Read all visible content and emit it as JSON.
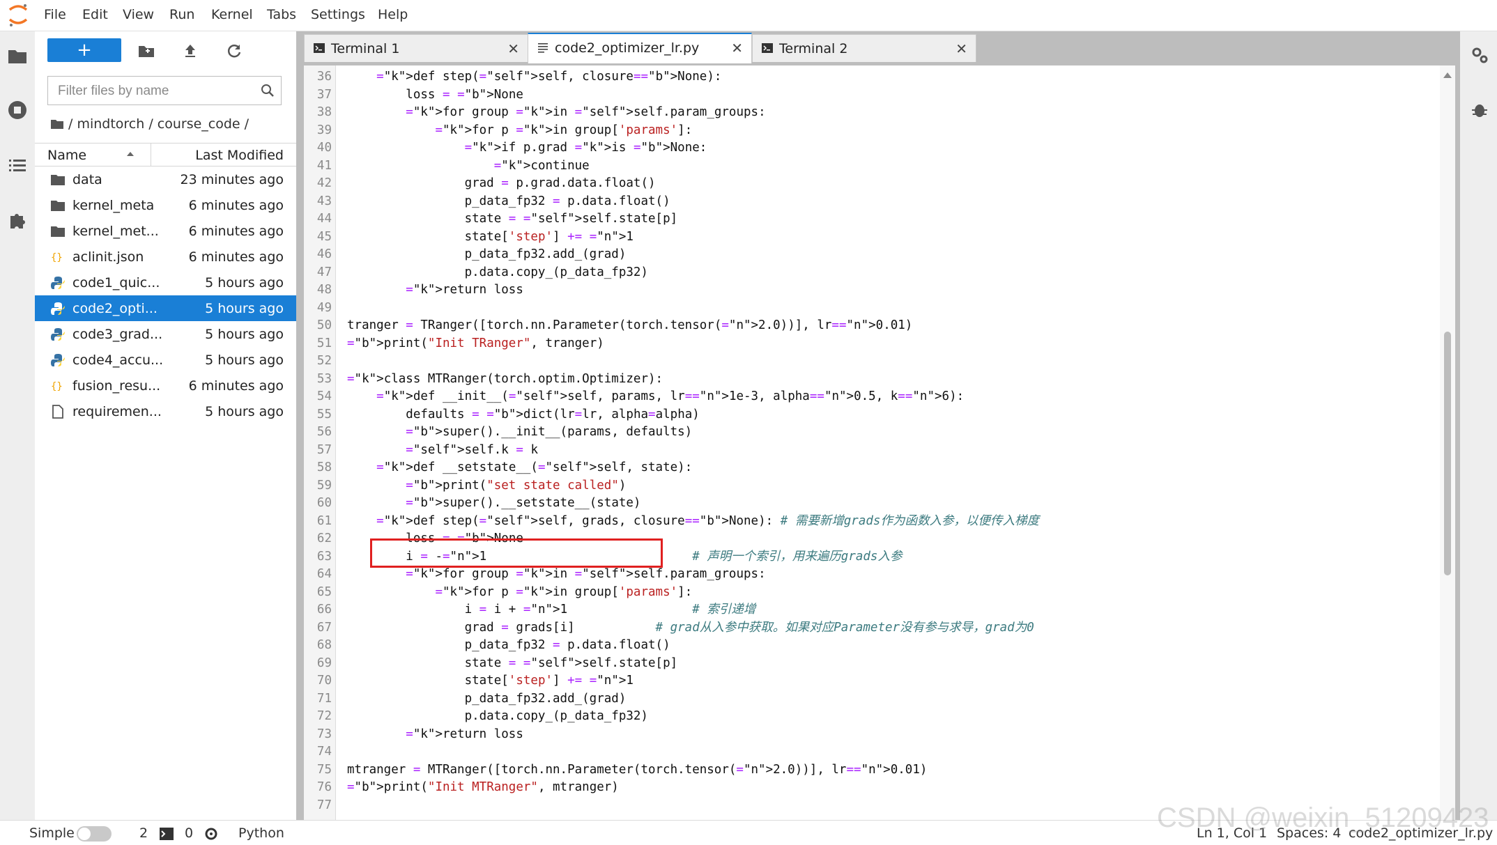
{
  "menubar": {
    "items": [
      "File",
      "Edit",
      "View",
      "Run",
      "Kernel",
      "Tabs",
      "Settings",
      "Help"
    ]
  },
  "filebrowser": {
    "new_label": "+",
    "filter_placeholder": "Filter files by name",
    "breadcrumb": "/ mindtorch / course_code /",
    "header": {
      "name": "Name",
      "modified": "Last Modified"
    },
    "files": [
      {
        "name": "data",
        "time": "23 minutes ago",
        "icon": "folder-icon"
      },
      {
        "name": "kernel_meta",
        "time": "6 minutes ago",
        "icon": "folder-icon"
      },
      {
        "name": "kernel_met...",
        "time": "6 minutes ago",
        "icon": "folder-icon"
      },
      {
        "name": "aclinit.json",
        "time": "6 minutes ago",
        "icon": "json-icon"
      },
      {
        "name": "code1_quic...",
        "time": "5 hours ago",
        "icon": "python-icon"
      },
      {
        "name": "code2_opti...",
        "time": "5 hours ago",
        "icon": "python-icon",
        "selected": true
      },
      {
        "name": "code3_grad...",
        "time": "5 hours ago",
        "icon": "python-icon"
      },
      {
        "name": "code4_accu...",
        "time": "5 hours ago",
        "icon": "python-icon"
      },
      {
        "name": "fusion_resu...",
        "time": "6 minutes ago",
        "icon": "json-icon"
      },
      {
        "name": "requiremen...",
        "time": "5 hours ago",
        "icon": "file-icon"
      }
    ]
  },
  "tabs": [
    {
      "label": "Terminal 1",
      "icon": "terminal-icon"
    },
    {
      "label": "code2_optimizer_lr.py",
      "icon": "text-file-icon",
      "active": true
    },
    {
      "label": "Terminal 2",
      "icon": "terminal-icon"
    }
  ],
  "editor": {
    "lines": [
      {
        "no": "36",
        "code": "    def step(self, closure=None):"
      },
      {
        "no": "37",
        "code": "        loss = None"
      },
      {
        "no": "38",
        "code": "        for group in self.param_groups:"
      },
      {
        "no": "39",
        "code": "            for p in group['params']:"
      },
      {
        "no": "40",
        "code": "                if p.grad is None:"
      },
      {
        "no": "41",
        "code": "                    continue"
      },
      {
        "no": "42",
        "code": "                grad = p.grad.data.float()"
      },
      {
        "no": "43",
        "code": "                p_data_fp32 = p.data.float()"
      },
      {
        "no": "44",
        "code": "                state = self.state[p]"
      },
      {
        "no": "45",
        "code": "                state['step'] += 1"
      },
      {
        "no": "46",
        "code": "                p_data_fp32.add_(grad)"
      },
      {
        "no": "47",
        "code": "                p.data.copy_(p_data_fp32)"
      },
      {
        "no": "48",
        "code": "        return loss"
      },
      {
        "no": "49",
        "code": ""
      },
      {
        "no": "50",
        "code": "tranger = TRanger([torch.nn.Parameter(torch.tensor(2.0))], lr=0.01)"
      },
      {
        "no": "51",
        "code": "print(\"Init TRanger\", tranger)"
      },
      {
        "no": "52",
        "code": ""
      },
      {
        "no": "53",
        "code": "class MTRanger(torch.optim.Optimizer):"
      },
      {
        "no": "54",
        "code": "    def __init__(self, params, lr=1e-3, alpha=0.5, k=6):"
      },
      {
        "no": "55",
        "code": "        defaults = dict(lr=lr, alpha=alpha)"
      },
      {
        "no": "56",
        "code": "        super().__init__(params, defaults)"
      },
      {
        "no": "57",
        "code": "        self.k = k"
      },
      {
        "no": "58",
        "code": "    def __setstate__(self, state):"
      },
      {
        "no": "59",
        "code": "        print(\"set state called\")"
      },
      {
        "no": "60",
        "code": "        super().__setstate__(state)"
      },
      {
        "no": "61",
        "code": "    def step(self, grads, closure=None): # 需要新增grads作为函数入参，以便传入梯度"
      },
      {
        "no": "62",
        "code": "        loss = None"
      },
      {
        "no": "63",
        "code": "        i = -1                            # 声明一个索引，用来遍历grads入参"
      },
      {
        "no": "64",
        "code": "        for group in self.param_groups:"
      },
      {
        "no": "65",
        "code": "            for p in group['params']:"
      },
      {
        "no": "66",
        "code": "                i = i + 1                 # 索引递增"
      },
      {
        "no": "67",
        "code": "                grad = grads[i]           # grad从入参中获取。如果对应Parameter没有参与求导，grad为0"
      },
      {
        "no": "68",
        "code": "                p_data_fp32 = p.data.float()"
      },
      {
        "no": "69",
        "code": "                state = self.state[p]"
      },
      {
        "no": "70",
        "code": "                state['step'] += 1"
      },
      {
        "no": "71",
        "code": "                p_data_fp32.add_(grad)"
      },
      {
        "no": "72",
        "code": "                p.data.copy_(p_data_fp32)"
      },
      {
        "no": "73",
        "code": "        return loss"
      },
      {
        "no": "74",
        "code": ""
      },
      {
        "no": "75",
        "code": "mtranger = MTRanger([torch.nn.Parameter(torch.tensor(2.0))], lr=0.01)"
      },
      {
        "no": "76",
        "code": "print(\"Init MTRanger\", mtranger)"
      },
      {
        "no": "77",
        "code": ""
      }
    ]
  },
  "statusbar": {
    "mode": "Simple",
    "terminals": "2",
    "kernels": "0",
    "kernel_name": "Python",
    "position": "Ln 1, Col 1",
    "spaces": "Spaces: 4",
    "filename": "code2_optimizer_lr.py"
  },
  "watermark": "CSDN @weixin_51209423",
  "colors": {
    "accent": "#1a7fd6",
    "highlight_box": "#e02020"
  }
}
